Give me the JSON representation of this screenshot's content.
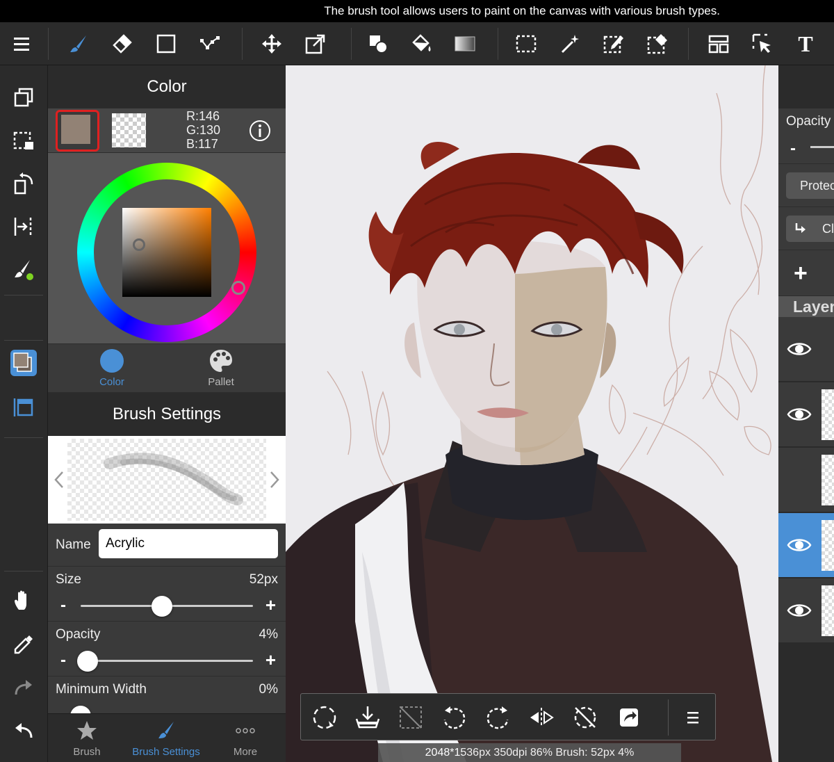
{
  "tooltip": "The brush tool allows users to paint on the canvas with various brush types.",
  "toolbar": {
    "tools": [
      "menu-icon",
      "brush-icon",
      "eraser-icon",
      "rect-icon",
      "vector-icon",
      "move-icon",
      "transform-icon",
      "fill-shape-icon",
      "bucket-icon",
      "gradient-icon",
      "select-rect-icon",
      "magic-wand-icon",
      "select-pen-icon",
      "select-eraser-icon",
      "layout-icon",
      "select-move-icon",
      "text-icon"
    ],
    "text_tool_glyph": "T"
  },
  "color_panel": {
    "title": "Color",
    "main_color": "#928275",
    "rgb": {
      "r": "R:146",
      "g": "G:130",
      "b": "B:117"
    },
    "tabs": [
      {
        "label": "Color",
        "active": true
      },
      {
        "label": "Pallet",
        "active": false
      }
    ]
  },
  "brush_settings": {
    "title": "Brush Settings",
    "name_label": "Name",
    "name_value": "Acrylic",
    "size": {
      "label": "Size",
      "value": "52px",
      "fraction": 0.47
    },
    "opacity": {
      "label": "Opacity",
      "value": "4%",
      "fraction": 0.04
    },
    "min_width": {
      "label": "Minimum Width",
      "value": "0%",
      "fraction": 0.0
    },
    "minus": "-",
    "plus": "+"
  },
  "bottom_tabs": [
    {
      "label": "Brush",
      "active": false
    },
    {
      "label": "Brush Settings",
      "active": true
    },
    {
      "label": "More",
      "active": false
    }
  ],
  "status_bar": "2048*1536px 350dpi 86% Brush: 52px 4%",
  "layer_panel": {
    "opacity_label": "Opacity",
    "opacity_minus": "-",
    "protect_label": "Protec",
    "clip_label": "Cl",
    "add_label": "+",
    "title": "Layer",
    "active_layer_index": 3
  },
  "colors": {
    "accent": "#4a90d6",
    "active_tab": "#4a90d6",
    "panel_dark": "#2b2b2b",
    "panel": "#3a3a3a"
  }
}
